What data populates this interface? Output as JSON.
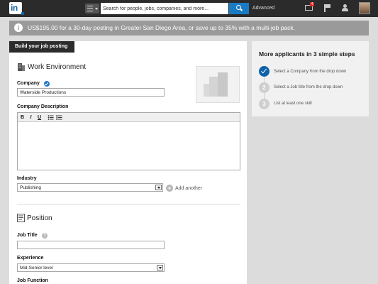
{
  "topbar": {
    "logo_text": "in",
    "search_placeholder": "Search for people, jobs, companies, and more...",
    "advanced_label": "Advanced",
    "notification_count": "4",
    "icons": [
      "linkedin-logo",
      "menu-icon",
      "search-icon",
      "mail-icon",
      "flag-icon",
      "add-connection-icon",
      "avatar"
    ]
  },
  "banner": {
    "info_glyph": "i",
    "text": "US$195.00 for a 30-day posting in Greater San Diego Area, or save up to 35% with a multi-job pack."
  },
  "form": {
    "tab_label": "Build your job posting",
    "work_environment": {
      "title": "Work Environment",
      "company_label": "Company",
      "company_value": "Waterside Productions",
      "description_label": "Company Description",
      "toolbar": {
        "bold": "B",
        "italic": "I",
        "underline": "U"
      },
      "industry_label": "Industry",
      "industry_value": "Publishing",
      "add_another_label": "Add another",
      "add_glyph": "+"
    },
    "position": {
      "title": "Position",
      "job_title_label": "Job Title",
      "job_title_value": "",
      "help_glyph": "?",
      "experience_label": "Experience",
      "experience_value": "Mid-Senior level",
      "job_function_label": "Job Function"
    }
  },
  "side_panel": {
    "title": "More applicants in 3 simple steps",
    "steps": [
      {
        "number": "1",
        "text": "Select a Company from the drop down",
        "done": true
      },
      {
        "number": "2",
        "text": "Select a Job title from the drop down",
        "done": false
      },
      {
        "number": "3",
        "text": "List at least one skill",
        "done": false
      }
    ]
  },
  "colors": {
    "topbar": "#2b2b2b",
    "accent_blue": "#0d62a8",
    "search_button": "#1a7bc4",
    "banner": "#9a9a9a",
    "page_bg": "#dcdcdc"
  }
}
